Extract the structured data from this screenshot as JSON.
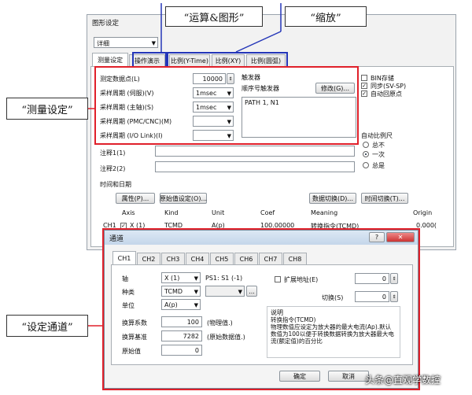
{
  "callouts": {
    "ops_graph": "“运算&图形”",
    "zoom": "“缩放”",
    "measure": "“测量设定”",
    "channel": "“设定通道”"
  },
  "main": {
    "title": "图形设定",
    "mode_select": "详细",
    "tabs": [
      "测量设定",
      "操作演示",
      "比例(Y-Time)",
      "比例(XY)",
      "比例(圆弧)"
    ],
    "fields": {
      "points_label": "测定数据点(L)",
      "points_value": "10000",
      "servo_label": "采样周期 (伺服)(V)",
      "servo_value": "1msec",
      "spindle_label": "采样周期 (主轴)(S)",
      "spindle_value": "1msec",
      "pmc_label": "采样周期 (PMC/CNC)(M)",
      "io_label": "采样周期 (I/O Link)(I)"
    },
    "trigger": {
      "title": "触发器",
      "seq_label": "顺序号触发器",
      "modify_button": "修改(G)...",
      "path_text": "PATH 1, N1"
    },
    "checks": [
      {
        "label": "BIN存储",
        "checked": false
      },
      {
        "label": "同步(SV-SP)",
        "checked": true
      },
      {
        "label": "自动回原点",
        "checked": true
      }
    ],
    "auto_scale": {
      "title": "自动比例尺",
      "options": [
        {
          "label": "总不",
          "selected": false
        },
        {
          "label": "一次",
          "selected": true
        },
        {
          "label": "总是",
          "selected": false
        }
      ]
    },
    "note1_label": "注释1(1)",
    "note2_label": "注释2(2)",
    "datetime_label": "时间和日期",
    "buttons": {
      "property": "属性(P)...",
      "original_setting": "原始值设定(O)...",
      "data_switch": "数据切换(D)...",
      "time_switch": "时间切换(T)..."
    },
    "table": {
      "headers": [
        "Axis",
        "Kind",
        "Unit",
        "Coef",
        "Meaning",
        "Origin"
      ],
      "ch_label": "CH1",
      "row1": [
        "X (1)",
        "TCMD",
        "A(p)",
        "100.00000",
        "转换指令(TCMD)",
        "0.000("
      ]
    }
  },
  "dialog": {
    "title": "通道",
    "help_icon": "?",
    "tabs": [
      "CH1",
      "CH2",
      "CH3",
      "CH4",
      "CH5",
      "CH6",
      "CH7",
      "CH8"
    ],
    "axis_label": "轴",
    "axis_value": "X (1)",
    "axis_info": "PS1: S1 (-1)",
    "kind_label": "种类",
    "kind_value": "TCMD",
    "unit_label": "单位",
    "unit_value": "A(p)",
    "ext_addr_label": "扩展地址(E)",
    "ext_addr_value": "0",
    "switch_label": "切换(S)",
    "switch_value": "0",
    "coef_label": "换算系数",
    "coef_value": "100",
    "coef_unit": "(物理值.)",
    "base_label": "换算基准",
    "base_value": "7282",
    "base_unit": "(原始数据值.)",
    "origin_label": "原始值",
    "origin_value": "0",
    "desc_title": "说明",
    "desc_text": "转换指令(TCMD)\n物理数值应设定为放大器的最大电流(Ap).默认数值为100以便于转换数据转换为放大器最大电流(额定值)的百分比",
    "ok_button": "确定",
    "cancel_button": "取消"
  },
  "watermark": "头条@直观学数控"
}
